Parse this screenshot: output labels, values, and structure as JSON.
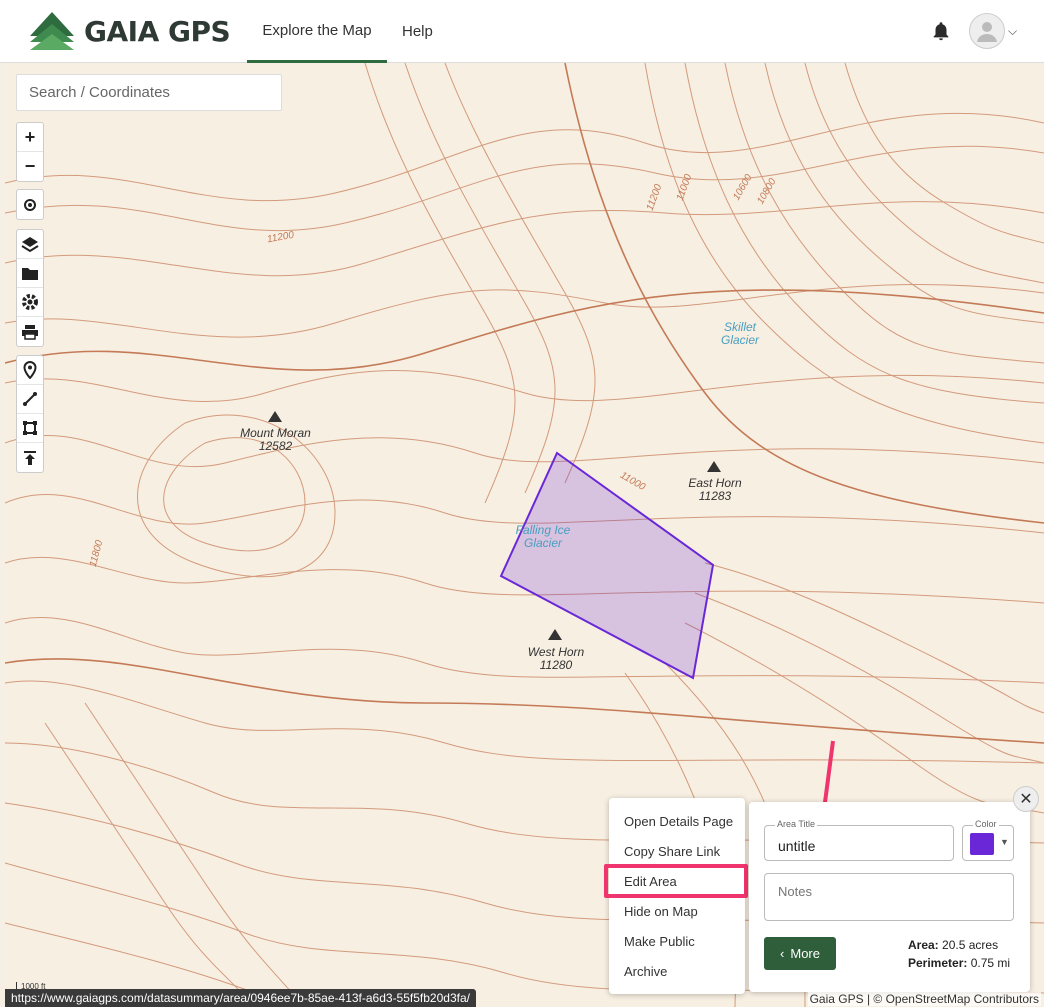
{
  "header": {
    "brand": "GAIA GPS",
    "nav": [
      {
        "label": "Explore the Map"
      },
      {
        "label": "Help"
      }
    ],
    "notifications_icon": "bell-icon",
    "account_icon": "user-avatar-icon"
  },
  "search": {
    "placeholder": "Search / Coordinates"
  },
  "map_labels": {
    "mount_moran_name": "Mount Moran",
    "mount_moran_elev": "12582",
    "east_horn_name": "East Horn",
    "east_horn_elev": "11283",
    "west_horn_name": "West Horn",
    "west_horn_elev": "11280",
    "skillet": "Skillet\nGlacier",
    "falling_ice": "Falling Ice\nGlacier",
    "contour_11200": "11200",
    "contour_11000": "11000",
    "contour_11800": "11800",
    "contour_10600": "10600",
    "contour_10800": "10800",
    "contour_11000b": "11000",
    "contour_11200b": "11200"
  },
  "context_menu": {
    "items": [
      {
        "label": "Open Details Page"
      },
      {
        "label": "Copy Share Link"
      },
      {
        "label": "Edit Area"
      },
      {
        "label": "Hide on Map"
      },
      {
        "label": "Make Public"
      },
      {
        "label": "Archive"
      }
    ],
    "highlighted": "Edit Area"
  },
  "area_panel": {
    "title_legend": "Area Title",
    "title_value": "untitle",
    "color_legend": "Color",
    "color": "#6a27d8",
    "notes_placeholder": "Notes",
    "more_label": "More",
    "area_label": "Area:",
    "area_value": "20.5 acres",
    "perimeter_label": "Perimeter:",
    "perimeter_value": "0.75 mi"
  },
  "scale": "1000 ft",
  "status_url": "https://www.gaiagps.com/datasummary/area/0946ee7b-85ae-413f-a6d3-55f5fb20d3fa/",
  "attribution": "Gaia GPS | © OpenStreetMap Contributors",
  "colors": {
    "brand_green": "#2e5f3a",
    "contour": "#c9896a",
    "area_fill": "#6a27d8",
    "annotation": "#f0346e"
  }
}
